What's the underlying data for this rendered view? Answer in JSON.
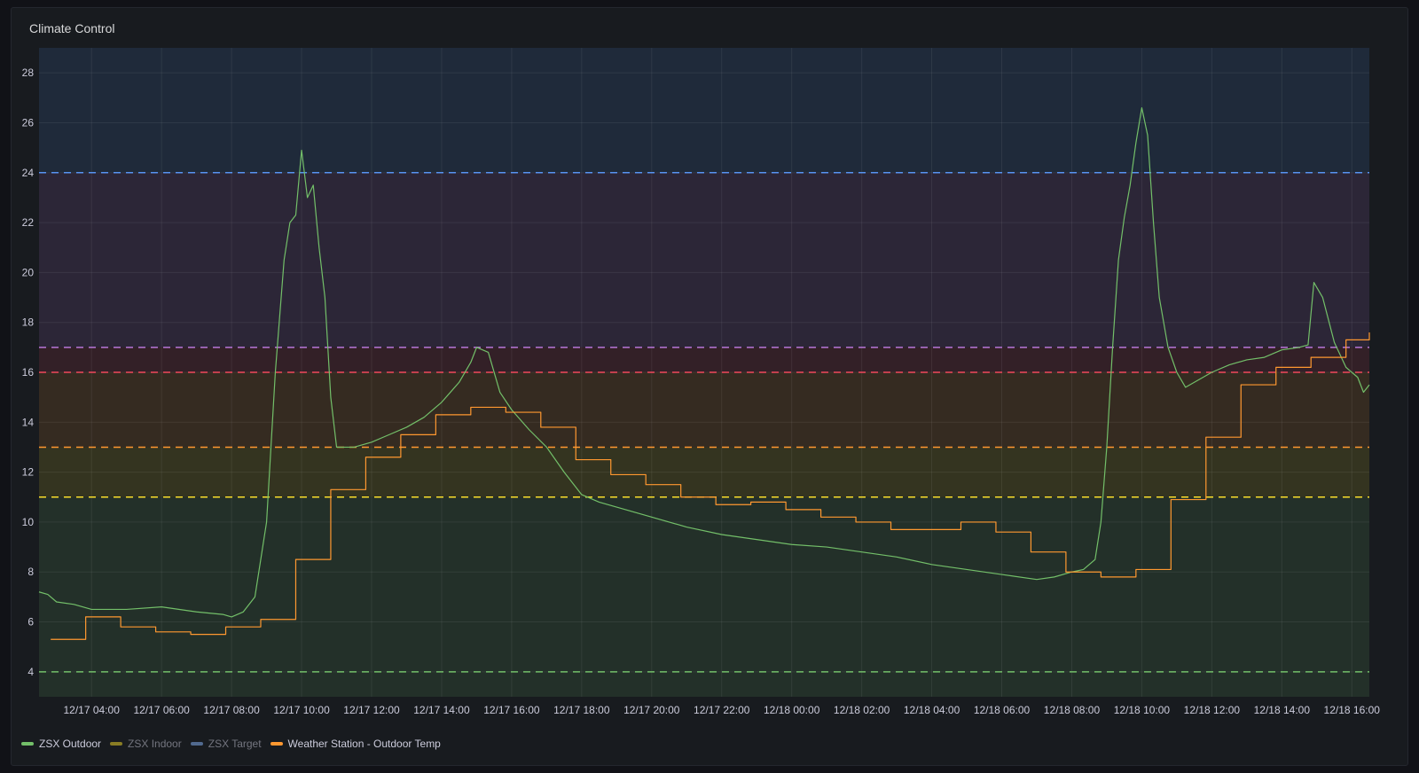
{
  "panel": {
    "title": "Climate Control"
  },
  "colors": {
    "zsx_outdoor": "#73bf69",
    "zsx_indoor": "#fade2a",
    "zsx_target": "#8ab8ff",
    "weather_station": "#ff9830"
  },
  "chart_data": {
    "type": "line",
    "title": "Climate Control",
    "xlabel": "",
    "ylabel": "",
    "ylim": [
      3,
      29
    ],
    "xlim": [
      "12/17 02:30",
      "12/18 16:30"
    ],
    "y_ticks": [
      4,
      6,
      8,
      10,
      12,
      14,
      16,
      18,
      20,
      22,
      24,
      26,
      28
    ],
    "x_ticks": [
      "12/17 04:00",
      "12/17 06:00",
      "12/17 08:00",
      "12/17 10:00",
      "12/17 12:00",
      "12/17 14:00",
      "12/17 16:00",
      "12/17 18:00",
      "12/17 20:00",
      "12/17 22:00",
      "12/18 00:00",
      "12/18 02:00",
      "12/18 04:00",
      "12/18 06:00",
      "12/18 08:00",
      "12/18 10:00",
      "12/18 12:00",
      "12/18 14:00",
      "12/18 16:00"
    ],
    "grid": true,
    "legend_position": "bottom-left",
    "threshold_bands": [
      {
        "from": 3,
        "to": 11,
        "color": "#73bf69"
      },
      {
        "from": 11,
        "to": 13,
        "color": "#fade2a"
      },
      {
        "from": 13,
        "to": 16,
        "color": "#ff9830"
      },
      {
        "from": 16,
        "to": 17,
        "color": "#f2495c"
      },
      {
        "from": 17,
        "to": 24,
        "color": "#b877d9"
      },
      {
        "from": 24,
        "to": 29,
        "color": "#5794f2"
      }
    ],
    "threshold_lines": [
      {
        "value": 4,
        "color": "#73bf69"
      },
      {
        "value": 11,
        "color": "#fade2a"
      },
      {
        "value": 13,
        "color": "#ff9830"
      },
      {
        "value": 16,
        "color": "#f2495c"
      },
      {
        "value": 17,
        "color": "#b877d9"
      },
      {
        "value": 24,
        "color": "#5794f2"
      }
    ],
    "series": [
      {
        "name": "ZSX Outdoor",
        "color": "#73bf69",
        "step": false,
        "x": [
          "12/17 02:30",
          "12/17 02:45",
          "12/17 03:00",
          "12/17 03:30",
          "12/17 04:00",
          "12/17 05:00",
          "12/17 06:00",
          "12/17 07:00",
          "12/17 07:45",
          "12/17 08:00",
          "12/17 08:20",
          "12/17 08:40",
          "12/17 09:00",
          "12/17 09:15",
          "12/17 09:30",
          "12/17 09:40",
          "12/17 09:50",
          "12/17 10:00",
          "12/17 10:10",
          "12/17 10:20",
          "12/17 10:30",
          "12/17 10:40",
          "12/17 10:50",
          "12/17 11:00",
          "12/17 11:30",
          "12/17 12:00",
          "12/17 12:30",
          "12/17 13:00",
          "12/17 13:30",
          "12/17 14:00",
          "12/17 14:30",
          "12/17 14:50",
          "12/17 15:00",
          "12/17 15:20",
          "12/17 15:40",
          "12/17 16:00",
          "12/17 16:30",
          "12/17 17:00",
          "12/17 17:30",
          "12/17 18:00",
          "12/17 18:30",
          "12/17 19:00",
          "12/17 19:30",
          "12/17 20:00",
          "12/17 21:00",
          "12/17 22:00",
          "12/17 23:00",
          "12/18 00:00",
          "12/18 01:00",
          "12/18 02:00",
          "12/18 03:00",
          "12/18 04:00",
          "12/18 05:00",
          "12/18 06:00",
          "12/18 07:00",
          "12/18 07:30",
          "12/18 08:00",
          "12/18 08:20",
          "12/18 08:40",
          "12/18 08:50",
          "12/18 09:00",
          "12/18 09:10",
          "12/18 09:20",
          "12/18 09:30",
          "12/18 09:40",
          "12/18 09:50",
          "12/18 10:00",
          "12/18 10:10",
          "12/18 10:20",
          "12/18 10:30",
          "12/18 10:45",
          "12/18 11:00",
          "12/18 11:15",
          "12/18 11:30",
          "12/18 12:00",
          "12/18 12:30",
          "12/18 13:00",
          "12/18 13:30",
          "12/18 14:00",
          "12/18 14:30",
          "12/18 14:45",
          "12/18 14:55",
          "12/18 15:10",
          "12/18 15:30",
          "12/18 15:50",
          "12/18 16:10",
          "12/18 16:20",
          "12/18 16:30"
        ],
        "values": [
          7.2,
          7.1,
          6.8,
          6.7,
          6.5,
          6.5,
          6.6,
          6.4,
          6.3,
          6.2,
          6.4,
          7.0,
          10.0,
          16.0,
          20.5,
          22.0,
          22.3,
          24.9,
          23.0,
          23.5,
          21.0,
          19.0,
          15.0,
          13.0,
          13.0,
          13.2,
          13.5,
          13.8,
          14.2,
          14.8,
          15.6,
          16.4,
          17.0,
          16.8,
          15.2,
          14.5,
          13.7,
          13.0,
          12.0,
          11.1,
          10.8,
          10.6,
          10.4,
          10.2,
          9.8,
          9.5,
          9.3,
          9.1,
          9.0,
          8.8,
          8.6,
          8.3,
          8.1,
          7.9,
          7.7,
          7.8,
          8.0,
          8.1,
          8.5,
          10.0,
          13.0,
          17.0,
          20.5,
          22.2,
          23.5,
          25.2,
          26.6,
          25.5,
          22.0,
          19.0,
          17.0,
          16.0,
          15.4,
          15.6,
          16.0,
          16.3,
          16.5,
          16.6,
          16.9,
          17.0,
          17.1,
          19.6,
          19.0,
          17.2,
          16.2,
          15.8,
          15.2,
          15.5
        ]
      },
      {
        "name": "ZSX Indoor",
        "color": "#fade2a",
        "hidden": true,
        "x": [],
        "values": []
      },
      {
        "name": "ZSX Target",
        "color": "#8ab8ff",
        "hidden": true,
        "x": [],
        "values": []
      },
      {
        "name": "Weather Station - Outdoor Temp",
        "color": "#ff9830",
        "step": true,
        "x": [
          "12/17 02:50",
          "12/17 03:50",
          "12/17 04:50",
          "12/17 05:50",
          "12/17 06:50",
          "12/17 07:50",
          "12/17 08:50",
          "12/17 09:50",
          "12/17 10:50",
          "12/17 11:50",
          "12/17 12:50",
          "12/17 13:50",
          "12/17 14:50",
          "12/17 15:50",
          "12/17 16:50",
          "12/17 17:50",
          "12/17 18:50",
          "12/17 19:50",
          "12/17 20:50",
          "12/17 21:50",
          "12/17 22:50",
          "12/17 23:50",
          "12/18 00:50",
          "12/18 01:50",
          "12/18 02:50",
          "12/18 03:50",
          "12/18 04:50",
          "12/18 05:50",
          "12/18 06:50",
          "12/18 07:50",
          "12/18 08:50",
          "12/18 09:50",
          "12/18 10:50",
          "12/18 11:50",
          "12/18 12:50",
          "12/18 13:50",
          "12/18 14:50",
          "12/18 15:50",
          "12/18 16:30"
        ],
        "values": [
          5.3,
          6.2,
          5.8,
          5.6,
          5.5,
          5.8,
          6.1,
          8.5,
          11.3,
          12.6,
          13.5,
          14.3,
          14.6,
          14.4,
          13.8,
          12.5,
          11.9,
          11.5,
          11.0,
          10.7,
          10.8,
          10.5,
          10.2,
          10.0,
          9.7,
          9.7,
          10.0,
          9.6,
          8.8,
          8.0,
          7.8,
          8.1,
          10.9,
          13.4,
          15.5,
          16.2,
          16.6,
          17.3,
          17.6
        ]
      }
    ]
  },
  "legend": {
    "items": [
      {
        "label": "ZSX Outdoor",
        "color": "#73bf69",
        "active": true
      },
      {
        "label": "ZSX Indoor",
        "color": "#fade2a",
        "active": false
      },
      {
        "label": "ZSX Target",
        "color": "#8ab8ff",
        "active": false
      },
      {
        "label": "Weather Station - Outdoor Temp",
        "color": "#ff9830",
        "active": true
      }
    ]
  }
}
